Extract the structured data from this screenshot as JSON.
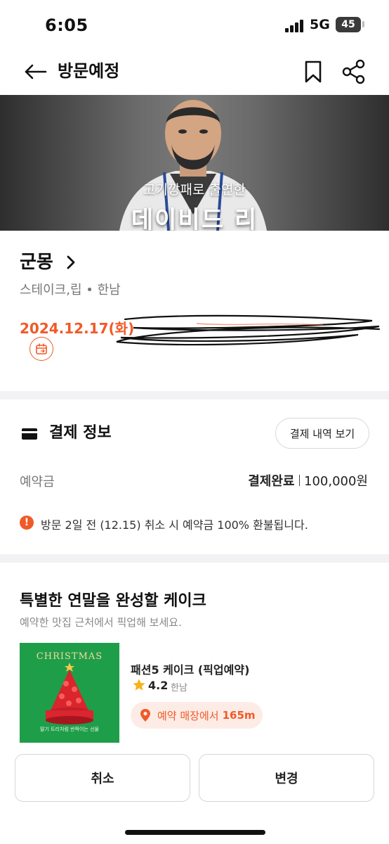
{
  "status_bar": {
    "time": "6:05",
    "network": "5G",
    "battery": "45"
  },
  "header": {
    "title": "방문예정",
    "back_icon": "back-arrow-icon",
    "bookmark_icon": "bookmark-icon",
    "share_icon": "share-icon"
  },
  "banner": {
    "subtitle": "고기깡패로 출연한",
    "title": "데이비드 리"
  },
  "restaurant": {
    "name": "군몽",
    "meta": "스테이크,립 • 한남",
    "visit_date": "2024.12.17(화)"
  },
  "payment": {
    "title": "결제 정보",
    "history_button": "결제 내역 보기",
    "deposit_label": "예약금",
    "deposit_status": "결제완료",
    "deposit_amount": "100,000원",
    "refund_note": "방문 2일 전 (12.15) 취소 시 예약금 100% 환불됩니다."
  },
  "cake": {
    "title": "특별한 연말을 완성할 케이크",
    "subtitle": "예약한 맛집 근처에서 픽업해 보세요.",
    "image_title": "CHRISTMAS",
    "image_caption": "딸기 트리처럼 반짝이는 선물",
    "product_name": "패션5 케이크 (픽업예약)",
    "rating": "4.2",
    "area": "한남",
    "distance_label": "예약 매장에서",
    "distance_value": "165m"
  },
  "actions": {
    "cancel": "취소",
    "change": "변경"
  },
  "colors": {
    "accent": "#f05a28",
    "divider": "#f2f2f4"
  }
}
